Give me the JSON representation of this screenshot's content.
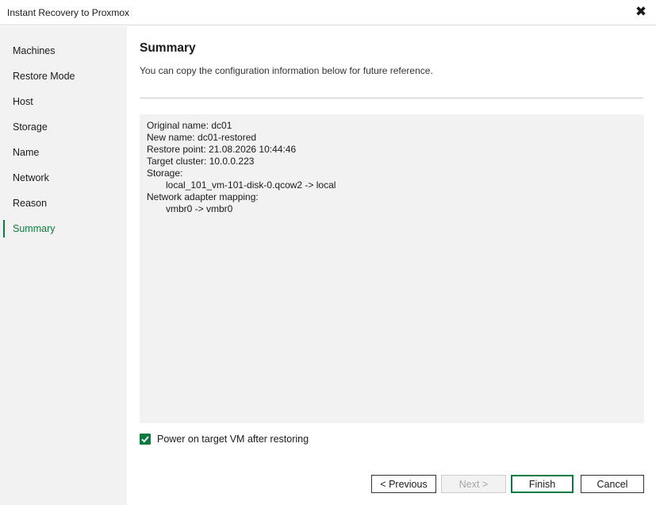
{
  "window": {
    "title": "Instant Recovery to Proxmox",
    "close_glyph": "✖",
    "close_icon": "close-icon"
  },
  "sidebar": {
    "items": [
      {
        "label": "Machines"
      },
      {
        "label": "Restore Mode"
      },
      {
        "label": "Host"
      },
      {
        "label": "Storage"
      },
      {
        "label": "Name"
      },
      {
        "label": "Network"
      },
      {
        "label": "Reason"
      },
      {
        "label": "Summary",
        "active": true
      }
    ]
  },
  "main": {
    "heading": "Summary",
    "subtitle": "You can copy the configuration information below for future reference.",
    "summary_lines": [
      {
        "text": "Original name: dc01"
      },
      {
        "text": "New name: dc01-restored"
      },
      {
        "text": "Restore point: 21.08.2026 10:44:46"
      },
      {
        "text": "Target cluster: 10.0.0.223"
      },
      {
        "text": "Storage:"
      },
      {
        "text": "local_101_vm-101-disk-0.qcow2 -> local",
        "indent": true
      },
      {
        "text": "Network adapter mapping:"
      },
      {
        "text": "vmbr0 -> vmbr0",
        "indent": true
      }
    ],
    "power_on": {
      "label": "Power on target VM after restoring",
      "checked": true
    }
  },
  "buttons": {
    "previous": "< Previous",
    "next": "Next >",
    "finish": "Finish",
    "cancel": "Cancel"
  },
  "colors": {
    "accent": "#0b7a3e",
    "sidebar_bg": "#f2f2f2",
    "summary_bg": "#f2f2f2"
  }
}
